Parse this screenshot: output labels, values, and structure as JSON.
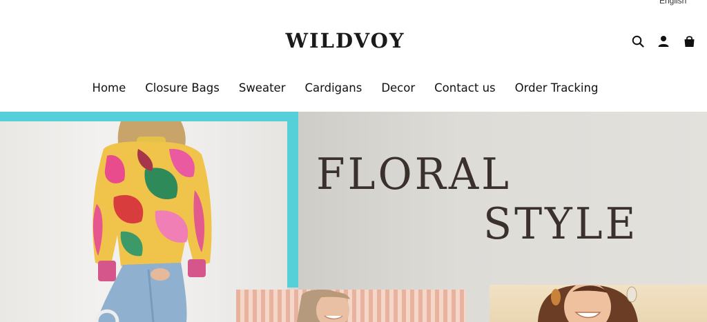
{
  "header": {
    "language": "English",
    "logo": "WILDVOY",
    "icons": [
      "search-icon",
      "account-icon",
      "cart-icon"
    ]
  },
  "nav": {
    "items": [
      {
        "label": "Home"
      },
      {
        "label": "Closure Bags"
      },
      {
        "label": "Sweater"
      },
      {
        "label": "Cardigans"
      },
      {
        "label": "Decor"
      },
      {
        "label": "Contact us"
      },
      {
        "label": "Order Tracking"
      }
    ]
  },
  "hero": {
    "headline_line1": "FLORAL",
    "headline_line2": "STYLE",
    "colors": {
      "frame": "#55d0d9",
      "background": "#dedcd7",
      "headline": "#3a302c"
    }
  }
}
